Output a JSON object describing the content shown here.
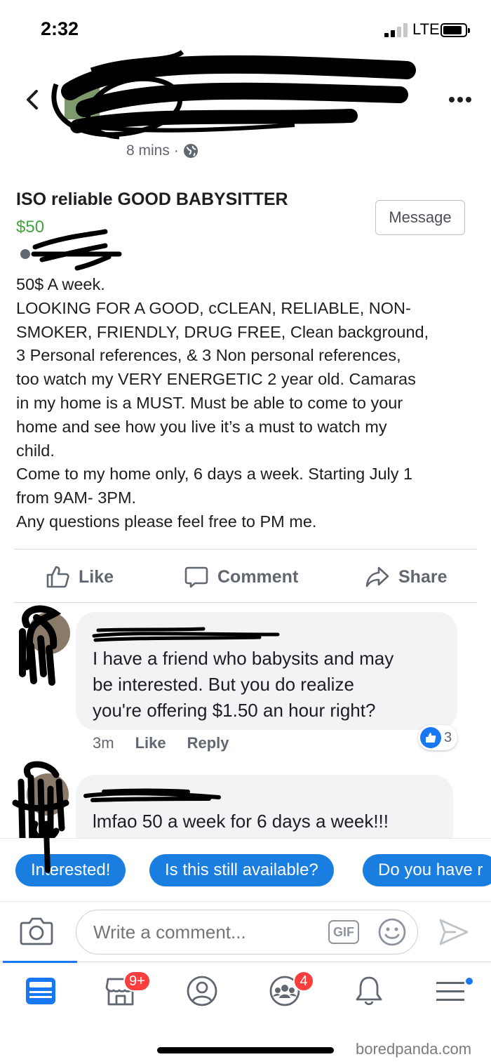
{
  "status_bar": {
    "time": "2:32",
    "network": "LTE"
  },
  "header": {
    "timestamp": "8 mins",
    "separator": "·"
  },
  "post": {
    "title": "ISO reliable GOOD BABYSITTER",
    "price": "$50",
    "message_label": "Message",
    "body_lines": [
      "50$ A week.",
      "LOOKING FOR A GOOD, cCLEAN, RELIABLE, NON-",
      "SMOKER, FRIENDLY, DRUG FREE, Clean background,",
      "3 Personal references, & 3 Non personal references,",
      "too watch my VERY ENERGETIC 2 year old. Camaras",
      "in my home is a MUST. Must be able to come to your",
      "home and see how you live it’s a must to watch my",
      "child.",
      "Come to my home only, 6 days a week. Starting July 1",
      "from 9AM- 3PM.",
      "Any questions please feel free to PM me."
    ]
  },
  "actions": {
    "like": "Like",
    "comment": "Comment",
    "share": "Share"
  },
  "comments": [
    {
      "text_lines": [
        "I have a friend who babysits and may",
        "be interested. But you do realize",
        "you're offering $1.50 an hour right?"
      ],
      "time": "3m",
      "like_label": "Like",
      "reply_label": "Reply",
      "reaction_count": "3"
    },
    {
      "text_lines": [
        "lmfao 50 a week for 6 days a week!!!"
      ]
    }
  ],
  "quick_replies": [
    "Interested!",
    "Is this still available?",
    "Do you have r"
  ],
  "composer": {
    "placeholder": "Write a comment...",
    "gif_label": "GIF"
  },
  "bottom_nav": {
    "marketplace_badge": "9+",
    "groups_badge": "4"
  },
  "watermark": "boredpanda.com",
  "colors": {
    "accent": "#1877f2",
    "price_green": "#42a33f",
    "chip_blue": "#1a7de0",
    "badge_red": "#fa3e3e"
  }
}
